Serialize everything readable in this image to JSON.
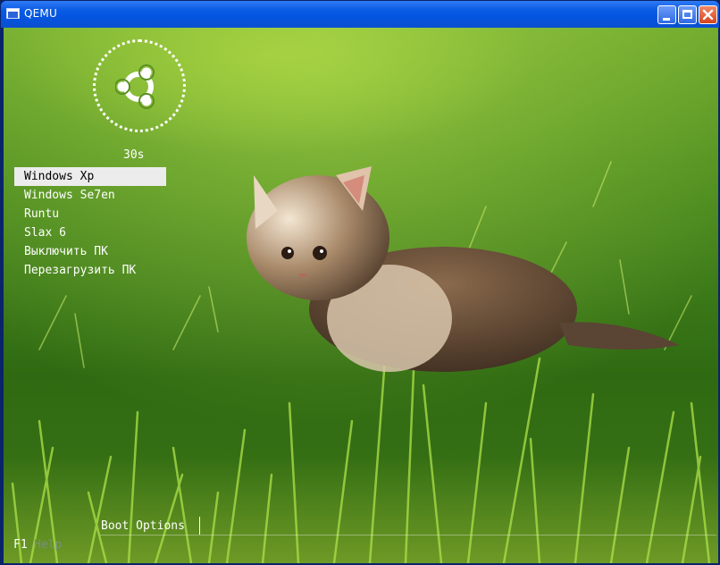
{
  "window": {
    "title": "QEMU",
    "controls": [
      "minimize",
      "maximize",
      "close"
    ]
  },
  "boot": {
    "timer": "30s",
    "menu": [
      {
        "label": "Windows Xp",
        "selected": true
      },
      {
        "label": "Windows Se7en",
        "selected": false
      },
      {
        "label": "Runtu",
        "selected": false
      },
      {
        "label": "Slax 6",
        "selected": false
      },
      {
        "label": "Выключить ПК",
        "selected": false
      },
      {
        "label": "Перезагрузить ПК",
        "selected": false
      }
    ],
    "boot_options_label": "Boot Options",
    "help_key": "F1",
    "help_label": "Help"
  },
  "colors": {
    "titlebar": "#0a5be4",
    "selected_bg": "#ececec",
    "grass": "#4d8d1f"
  },
  "icons": [
    "app-window-icon",
    "ubuntu-logo-icon",
    "minimize-icon",
    "maximize-icon",
    "close-icon"
  ]
}
